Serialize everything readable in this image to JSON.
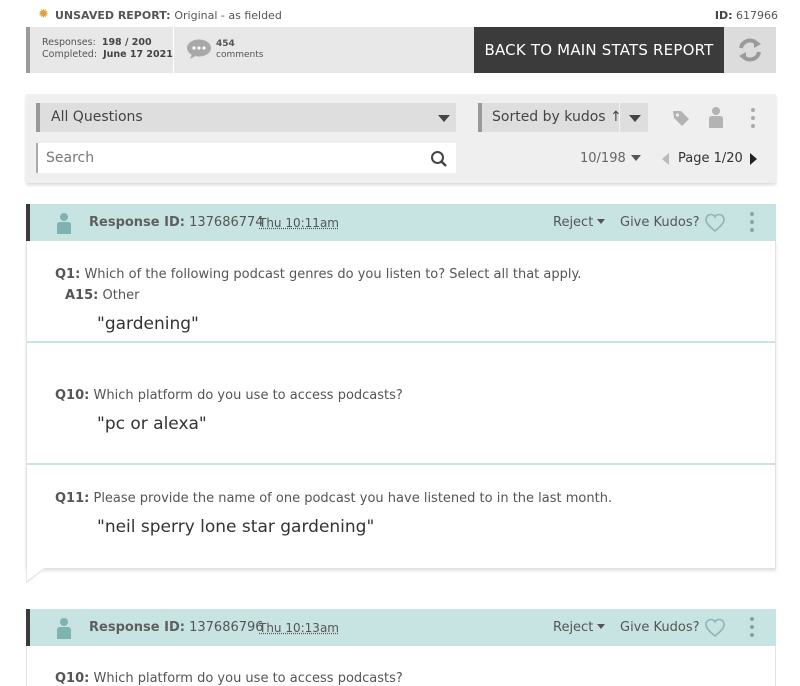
{
  "report": {
    "status_label": "UNSAVED REPORT:",
    "status_detail": "Original - as fielded",
    "id_label": "ID:",
    "id_value": "617966"
  },
  "stats": {
    "responses_label": "Responses:",
    "responses_value": "198 / 200",
    "completed_label": "Completed:",
    "completed_value": "June 17 2021",
    "comments_count": "454",
    "comments_label": "comments",
    "back_button": "BACK TO MAIN STATS REPORT"
  },
  "filters": {
    "question_filter": "All Questions",
    "sort_label": "Sorted by kudos ↑",
    "search_placeholder": "Search",
    "per_page": "10/198",
    "page_label": "Page 1/20"
  },
  "responses": [
    {
      "id_label": "Response ID:",
      "id": "137686774",
      "time": "Thu 10:11am",
      "reject_label": "Reject",
      "kudos_label": "Give Kudos?",
      "items": [
        {
          "q_num": "Q1:",
          "q_text": "Which of the following podcast genres do you listen to? Select all that apply.",
          "a_num": "A15:",
          "a_text": "Other",
          "answer": "\"gardening\""
        },
        {
          "q_num": "Q10:",
          "q_text": "Which platform do you use to access podcasts?",
          "answer": "\"pc or alexa\""
        },
        {
          "q_num": "Q11:",
          "q_text": "Please provide the name of one podcast you have listened to in the last month.",
          "answer": "\"neil sperry lone star gardening\""
        }
      ]
    },
    {
      "id_label": "Response ID:",
      "id": "137686796",
      "time": "Thu 10:13am",
      "reject_label": "Reject",
      "kudos_label": "Give Kudos?",
      "peek_q_num": "Q10:",
      "peek_q_text": "Which platform do you use to access podcasts?"
    }
  ],
  "colors": {
    "accent_teal": "#c7e4e3",
    "dark_button": "#3b3b3b",
    "gear_orange": "#e4a23a"
  }
}
